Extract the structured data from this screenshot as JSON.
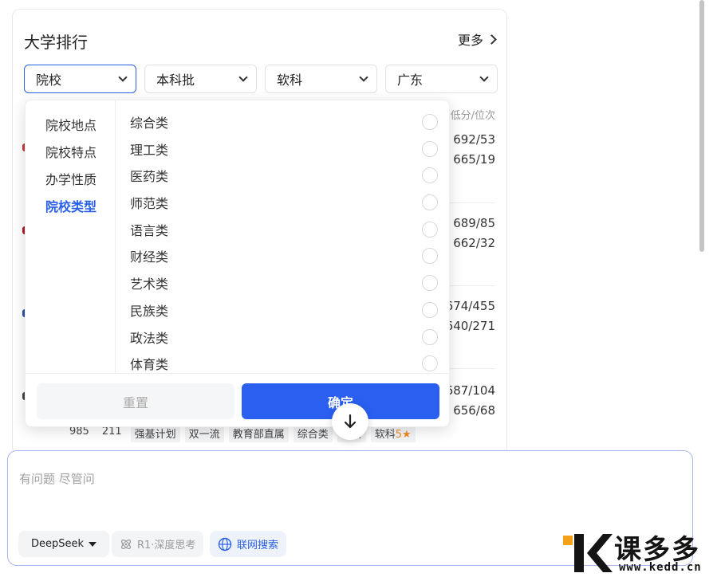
{
  "card": {
    "title": "大学排行",
    "more": "更多",
    "filters": [
      {
        "label": "院校"
      },
      {
        "label": "本科批"
      },
      {
        "label": "软科"
      },
      {
        "label": "广东"
      }
    ],
    "list_header": "最低分/位次",
    "rows": [
      {
        "line1": "理 692/53",
        "line2": "理 665/19"
      },
      {
        "line1": "理 689/85",
        "line2": "理 662/32"
      },
      {
        "line1": "674/455",
        "line2": "640/271"
      },
      {
        "line1": "687/104",
        "line2": "656/68"
      }
    ],
    "tags": [
      "985",
      "211",
      "强基计划",
      "双一流",
      "教育部直属",
      "综合类",
      "保研",
      "软科"
    ],
    "tag_rating": "5"
  },
  "dropdown": {
    "categories": [
      "院校地点",
      "院校特点",
      "办学性质",
      "院校类型"
    ],
    "active_category": "院校类型",
    "options": [
      "综合类",
      "理工类",
      "医药类",
      "师范类",
      "语言类",
      "财经类",
      "艺术类",
      "民族类",
      "政法类",
      "体育类"
    ],
    "reset": "重置",
    "confirm": "确定"
  },
  "chat": {
    "placeholder": "有问题 尽管问",
    "model": "DeepSeek",
    "think": "R1·深度思考",
    "search": "联网搜索"
  },
  "watermark": {
    "brand": "课多多",
    "url": "www.kedd.cn"
  },
  "colors": {
    "accent": "#2a5ff0",
    "watermark_orange": "#f5a21b"
  }
}
